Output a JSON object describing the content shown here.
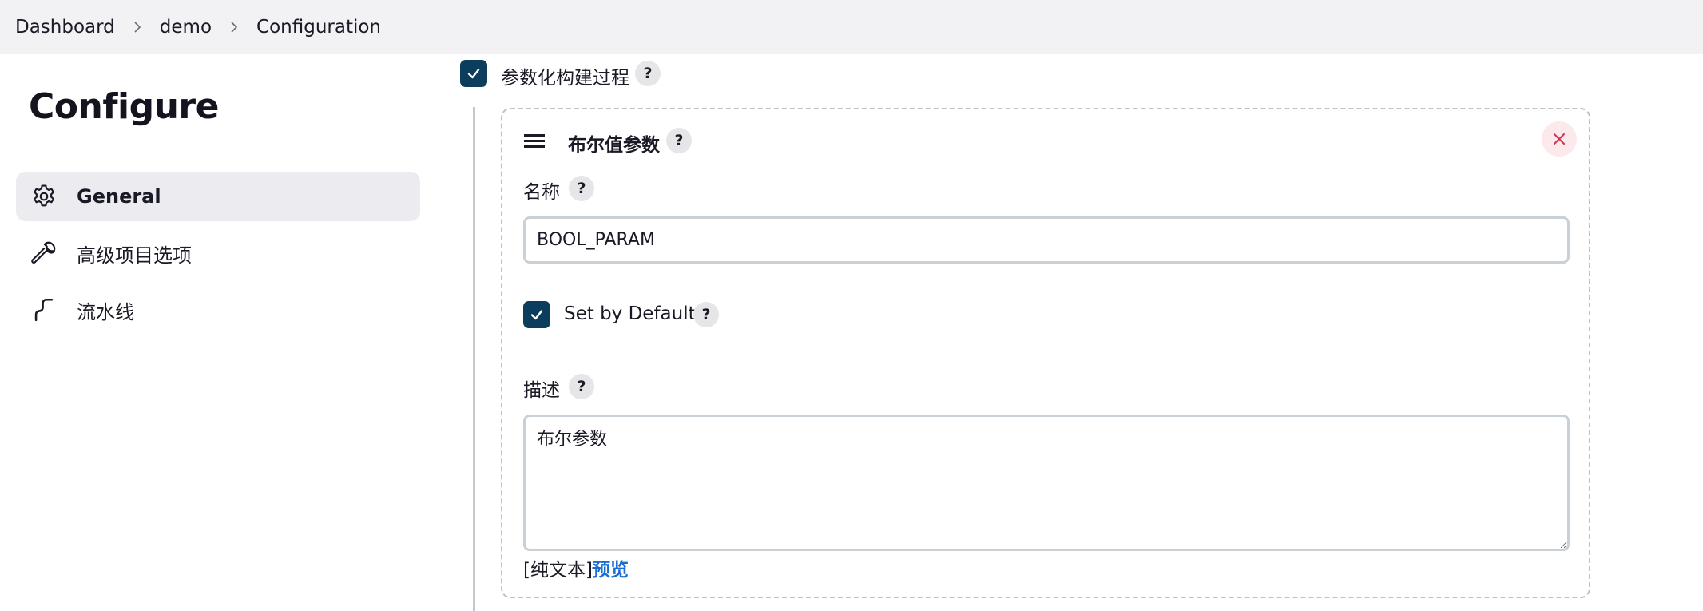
{
  "breadcrumb": {
    "items": [
      "Dashboard",
      "demo",
      "Configuration"
    ]
  },
  "sidebar": {
    "title": "Configure",
    "items": [
      {
        "label": "General",
        "icon": "gear-icon",
        "active": true
      },
      {
        "label": "高级项目选项",
        "icon": "wrench-icon",
        "active": false
      },
      {
        "label": "流水线",
        "icon": "pipeline-icon",
        "active": false
      }
    ]
  },
  "main": {
    "parameterized": {
      "label": "参数化构建过程",
      "checked": true,
      "help": "?"
    },
    "param_card": {
      "title": "布尔值参数",
      "help": "?",
      "name_label": "名称",
      "name_value": "BOOL_PARAM",
      "default_label": "Set by Default",
      "default_checked": true,
      "desc_label": "描述",
      "desc_value": "布尔参数",
      "format_text": "[纯文本]",
      "preview_label": "预览"
    }
  },
  "colors": {
    "accent": "#0b3d5c",
    "link": "#1a6ed0",
    "close": "#d1334f",
    "topbar_bg": "#f2f2f4",
    "active_item_bg": "#ebebf0"
  }
}
